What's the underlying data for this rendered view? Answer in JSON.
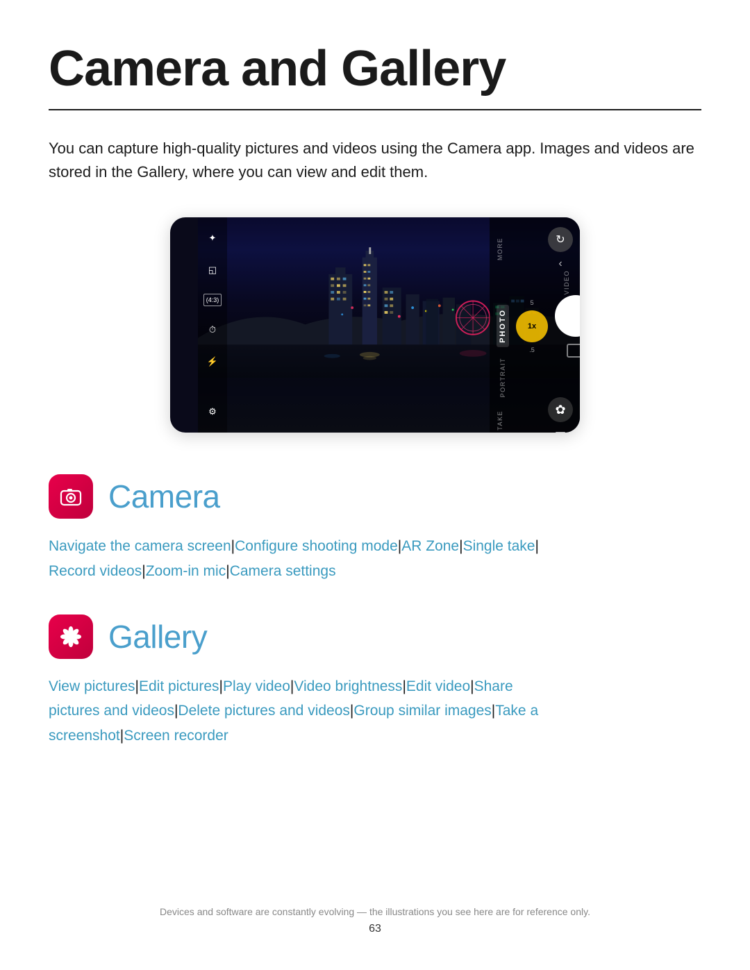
{
  "page": {
    "title": "Camera and Gallery",
    "intro": "You can capture high-quality pictures and videos using the Camera app. Images and videos are stored in the Gallery, where you can view and edit them.",
    "footer_disclaimer": "Devices and software are constantly evolving — the illustrations you see here are for reference only.",
    "footer_page": "63"
  },
  "camera_section": {
    "app_name": "Camera",
    "icon_label": "camera-app-icon",
    "links": [
      "Navigate the camera screen",
      "Configure shooting mode",
      "AR Zone",
      "Single take",
      "Record videos",
      "Zoom-in mic",
      "Camera settings"
    ]
  },
  "gallery_section": {
    "app_name": "Gallery",
    "icon_label": "gallery-app-icon",
    "links": [
      "View pictures",
      "Edit pictures",
      "Play video",
      "Video brightness",
      "Edit video",
      "Share pictures and videos",
      "Delete pictures and videos",
      "Group similar images",
      "Take a screenshot",
      "Screen recorder"
    ]
  },
  "camera_ui": {
    "modes": [
      "MORE",
      "VIDEO",
      "PHOTO",
      "PORTRAIT",
      "TAKE"
    ],
    "active_mode": "PHOTO",
    "zoom_levels": [
      "5",
      "1x",
      ".5"
    ],
    "icons_left": [
      "✦",
      "◱",
      "4:3",
      "⏱",
      "⚡",
      "⚙"
    ]
  }
}
